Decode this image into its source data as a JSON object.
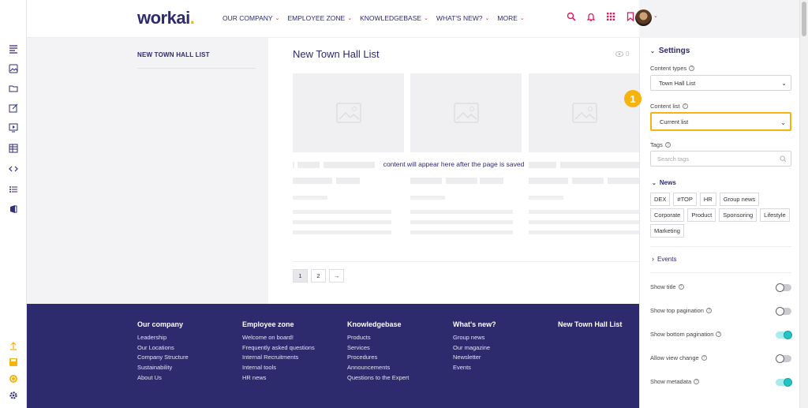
{
  "brand": {
    "name": "workai",
    "dot": ".",
    "accent": "#f6b20d",
    "primary": "#2d2a6e",
    "pink": "#e0195e"
  },
  "leftbar": {
    "icons": [
      "list-icon",
      "image-icon",
      "folder-icon",
      "edit-icon",
      "presentation-icon",
      "table-icon",
      "code-icon",
      "bullet-list-icon",
      "office-icon"
    ],
    "bottom_icons": [
      "upload-icon",
      "save-icon",
      "coin-icon",
      "gear-icon"
    ]
  },
  "nav": {
    "items": [
      {
        "label": "OUR COMPANY"
      },
      {
        "label": "EMPLOYEE ZONE"
      },
      {
        "label": "KNOWLEDGEBASE"
      },
      {
        "label": "WHAT'S NEW?"
      },
      {
        "label": "MORE"
      }
    ],
    "chevron": "⌄",
    "icons": [
      "search-icon",
      "bell-icon",
      "apps-grid-icon",
      "bookmark-icon"
    ]
  },
  "sidebar": {
    "title": "NEW TOWN HALL LIST"
  },
  "main": {
    "title": "New Town Hall List",
    "views_count": "0",
    "notice": "content will appear here after the page is saved",
    "pagination": {
      "pages": [
        "1",
        "2"
      ],
      "next": "→",
      "active": "1"
    }
  },
  "footer": {
    "columns": [
      {
        "heading": "Our company",
        "links": [
          "Leadership",
          "Our Locations",
          "Company Structure",
          "Sustainability",
          "About Us"
        ]
      },
      {
        "heading": "Employee zone",
        "links": [
          "Welcome on board!",
          "Frequently asked questions",
          "Internal Recruitments",
          "Internal tools",
          "HR news"
        ]
      },
      {
        "heading": "Knowledgebase",
        "links": [
          "Products",
          "Services",
          "Procedures",
          "Announcements",
          "Questions to the Expert"
        ]
      },
      {
        "heading": "What's new?",
        "links": [
          "Group news",
          "Our magazine",
          "Newsletter",
          "Events"
        ]
      },
      {
        "heading": "New Town Hall List",
        "links": []
      }
    ]
  },
  "settings": {
    "title": "Settings",
    "content_types_label": "Content types",
    "content_types_value": "Town Hall List",
    "content_list_label": "Content list",
    "content_list_value": "Current list",
    "step_badge": "1",
    "tags_label": "Tags",
    "tags_placeholder": "Search tags",
    "news_label": "News",
    "news_tags": [
      "DEX",
      "#TOP",
      "HR",
      "Group news",
      "Corporate",
      "Product",
      "Sponsoring",
      "Lifestyle",
      "Marketing"
    ],
    "events_label": "Events",
    "toggles": [
      {
        "label": "Show title",
        "on": false
      },
      {
        "label": "Show top pagination",
        "on": false
      },
      {
        "label": "Show bottom pagination",
        "on": true
      },
      {
        "label": "Allow view change",
        "on": false
      },
      {
        "label": "Show metadata",
        "on": true
      }
    ]
  }
}
